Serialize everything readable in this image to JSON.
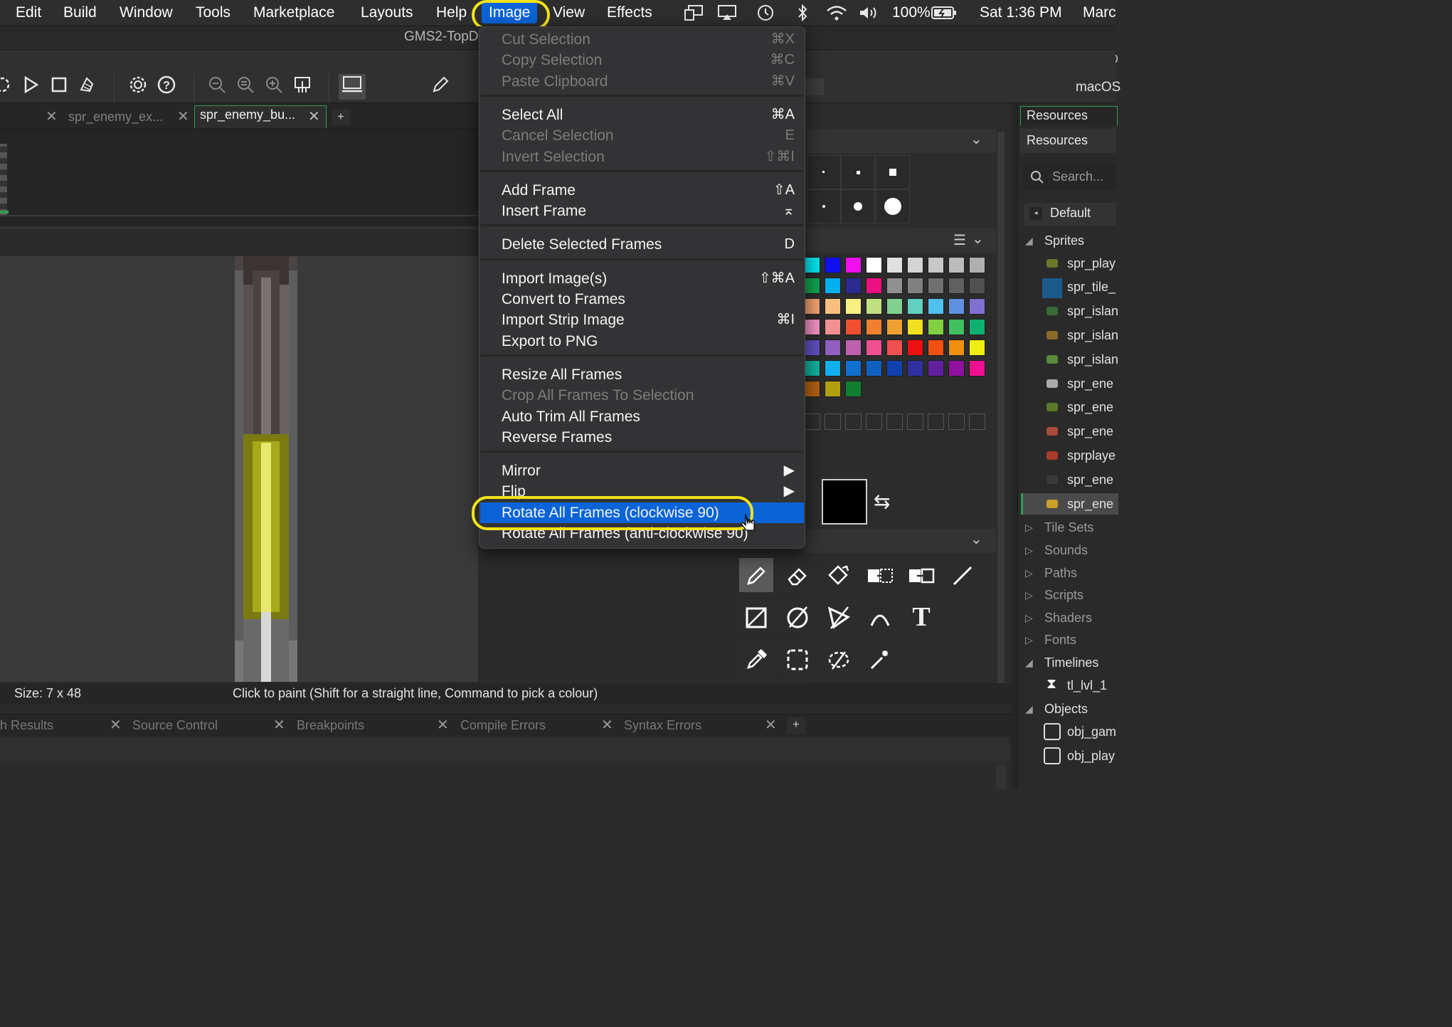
{
  "menubar": {
    "items": [
      "Edit",
      "Build",
      "Window",
      "Tools",
      "Marketplace",
      "Layouts",
      "Help",
      "Image",
      "View",
      "Effects"
    ],
    "battery": "100%",
    "clock": "Sat 1:36 PM",
    "right_label": "Marc"
  },
  "window": {
    "title": "GMS2-TopD",
    "right_label_id": "ID",
    "right_label_target": "macOS"
  },
  "tabs": [
    {
      "label": "spr_enemy_ex...",
      "active": false
    },
    {
      "label": "spr_enemy_bu...",
      "active": true
    }
  ],
  "tab_add": "+",
  "image_menu": {
    "groups": [
      [
        {
          "label": "Cut Selection",
          "shortcut": "⌘X",
          "enabled": false
        },
        {
          "label": "Copy Selection",
          "shortcut": "⌘C",
          "enabled": false
        },
        {
          "label": "Paste Clipboard",
          "shortcut": "⌘V",
          "enabled": false
        }
      ],
      [
        {
          "label": "Select All",
          "shortcut": "⌘A",
          "enabled": true
        },
        {
          "label": "Cancel Selection",
          "shortcut": "E",
          "enabled": false
        },
        {
          "label": "Invert Selection",
          "shortcut": "⇧⌘I",
          "enabled": false
        }
      ],
      [
        {
          "label": "Add Frame",
          "shortcut": "⇧A",
          "enabled": true
        },
        {
          "label": "Insert Frame",
          "shortcut": "⌅",
          "enabled": true
        }
      ],
      [
        {
          "label": "Delete Selected Frames",
          "shortcut": "D",
          "enabled": true
        }
      ],
      [
        {
          "label": "Import Image(s)",
          "shortcut": "⇧⌘A",
          "enabled": true
        },
        {
          "label": "Convert to Frames",
          "shortcut": "",
          "enabled": true
        },
        {
          "label": "Import Strip Image",
          "shortcut": "⌘I",
          "enabled": true
        },
        {
          "label": "Export to PNG",
          "shortcut": "",
          "enabled": true
        }
      ],
      [
        {
          "label": "Resize All Frames",
          "shortcut": "",
          "enabled": true
        },
        {
          "label": "Crop All Frames To Selection",
          "shortcut": "",
          "enabled": false
        },
        {
          "label": "Auto Trim All Frames",
          "shortcut": "",
          "enabled": true
        },
        {
          "label": "Reverse Frames",
          "shortcut": "",
          "enabled": true
        }
      ],
      [
        {
          "label": "Mirror",
          "shortcut": "▶",
          "enabled": true
        },
        {
          "label": "Flip",
          "shortcut": "▶",
          "enabled": true
        },
        {
          "label": "Rotate All Frames (clockwise 90)",
          "shortcut": "",
          "enabled": true,
          "selected": true
        },
        {
          "label": "Rotate All Frames (anti-clockwise 90)",
          "shortcut": "",
          "enabled": true
        }
      ]
    ]
  },
  "palette": [
    [
      "#00e5ee",
      "#1010ee",
      "#ee10ee",
      "#ffffff",
      "#e0e0e0",
      "#d4d4d4",
      "#c8c8c8",
      "#bcbcbc",
      "#b0b0b0"
    ],
    [
      "#10a050",
      "#00b0ee",
      "#2a2a90",
      "#ee1080",
      "#909090",
      "#808080",
      "#707070",
      "#606060",
      "#505050"
    ],
    [
      "#f0a070",
      "#f8c080",
      "#f8f080",
      "#c0e080",
      "#80d090",
      "#60d0c0",
      "#50c0ee",
      "#6090e0",
      "#8070d0"
    ],
    [
      "#f090c0",
      "#f09090",
      "#f05030",
      "#f08030",
      "#f0a030",
      "#f0e020",
      "#80d040",
      "#40c060",
      "#10b070"
    ],
    [
      "#6050c0",
      "#9060c0",
      "#c060b0",
      "#f05090",
      "#f05050",
      "#ee1010",
      "#f05010",
      "#f09010",
      "#eeee10"
    ],
    [
      "#10b0a0",
      "#10b0ee",
      "#1070d0",
      "#1060c0",
      "#1040b0",
      "#3030a0",
      "#6020a0",
      "#9010a0",
      "#ee1090"
    ],
    [
      "#b06010",
      "#b0a010",
      "#108030"
    ]
  ],
  "resources": {
    "title": "Resources",
    "subtitle": "Resources",
    "search_placeholder": "Search...",
    "default_label": "Default",
    "groups": [
      {
        "name": "Sprites",
        "expanded": true,
        "items": [
          "spr_play",
          "spr_tile_",
          "spr_islan",
          "spr_islan",
          "spr_islan",
          "spr_ene",
          "spr_ene",
          "spr_ene",
          "sprplaye",
          "spr_ene",
          "spr_ene"
        ]
      },
      {
        "name": "Tile Sets",
        "expanded": false,
        "items": []
      },
      {
        "name": "Sounds",
        "expanded": false,
        "items": []
      },
      {
        "name": "Paths",
        "expanded": false,
        "items": []
      },
      {
        "name": "Scripts",
        "expanded": false,
        "items": []
      },
      {
        "name": "Shaders",
        "expanded": false,
        "items": []
      },
      {
        "name": "Fonts",
        "expanded": false,
        "items": []
      },
      {
        "name": "Timelines",
        "expanded": true,
        "items": [
          "tl_lvl_1"
        ]
      },
      {
        "name": "Objects",
        "expanded": true,
        "items": [
          "obj_gam",
          "obj_play"
        ]
      }
    ]
  },
  "status": {
    "size": "Size: 7 x 48",
    "hint": "Click to paint (Shift for a straight line, Command to pick a colour)"
  },
  "bottom_tabs": [
    "h Results",
    "Source Control",
    "Breakpoints",
    "Compile Errors",
    "Syntax Errors"
  ],
  "bottom_add": "+",
  "colors": {
    "accent": "#0a64d8",
    "highlight_ring": "#f2e41a",
    "active_tab_border": "#2f9e52"
  }
}
